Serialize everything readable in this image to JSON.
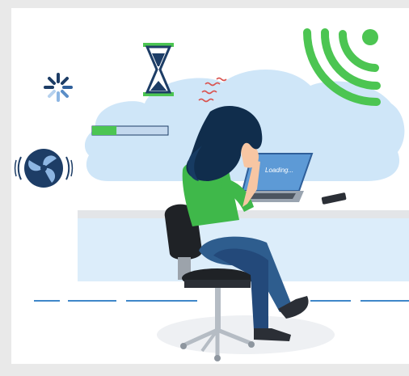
{
  "laptop": {
    "screen_text": "Loading..."
  },
  "progress_bar": {
    "fraction": 0.32
  },
  "colors": {
    "accent_green": "#4cc552",
    "cloud_blue": "#c9e3f7",
    "dark_navy": "#1d3d66",
    "shirt_green": "#3fb84a",
    "jeans_blue": "#2e5d8e",
    "hair": "#102d4c",
    "red_stress": "#d9534f"
  },
  "icons": [
    "spinner-icon",
    "hourglass-icon",
    "wifi-icon",
    "fan-icon",
    "phone-icon"
  ]
}
